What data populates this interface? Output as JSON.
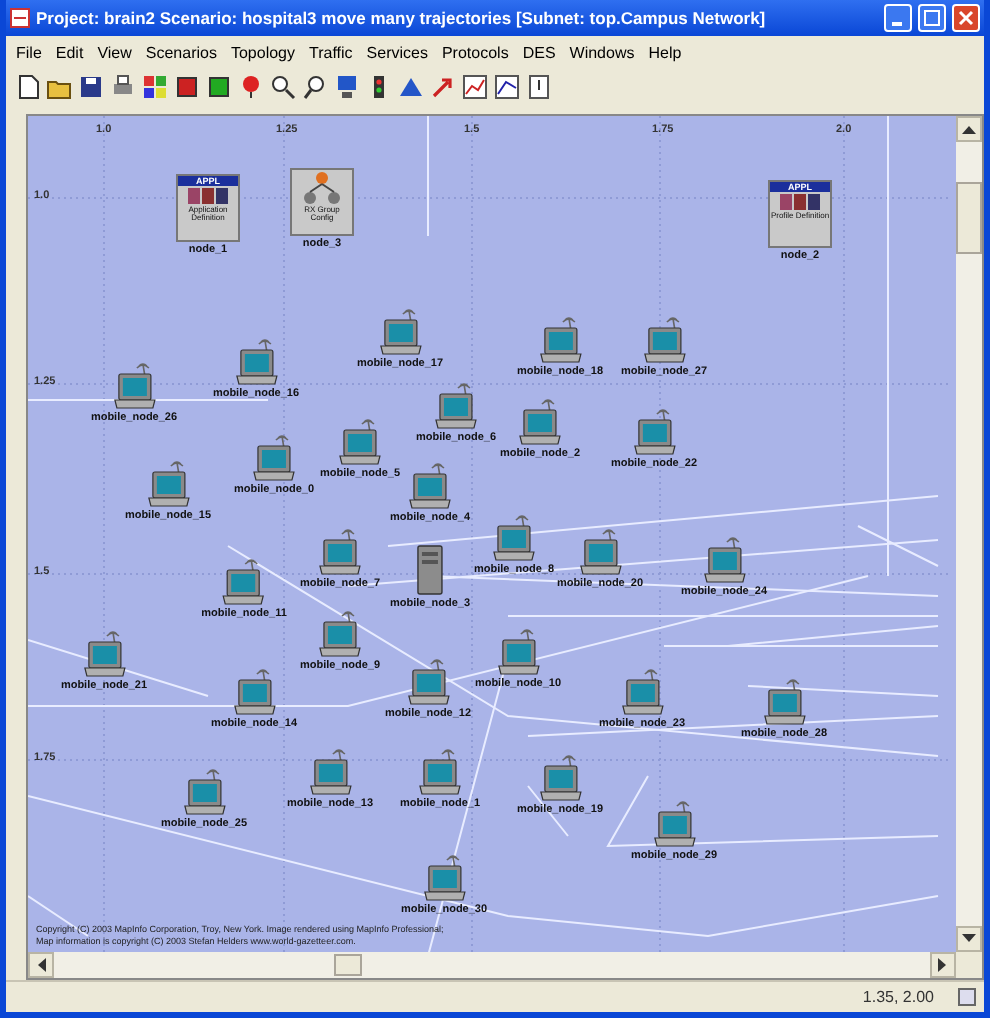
{
  "window": {
    "title": "Project: brain2 Scenario: hospital3 move many trajectories  [Subnet: top.Campus Network]"
  },
  "menu": [
    "File",
    "Edit",
    "View",
    "Scenarios",
    "Topology",
    "Traffic",
    "Services",
    "Protocols",
    "DES",
    "Windows",
    "Help"
  ],
  "canvas": {
    "x_ticks": [
      "1.0",
      "1.25",
      "1.5",
      "1.75",
      "2.0"
    ],
    "y_ticks": [
      "1.0",
      "1.25",
      "1.5",
      "1.75"
    ],
    "nodes": [
      {
        "kind": "application_definition",
        "badge": "APPL",
        "caption": "Application Definition",
        "label": "node_1"
      },
      {
        "kind": "rx_group_config",
        "caption": "RX Group Config",
        "label": "node_3"
      },
      {
        "kind": "profile_definition",
        "badge": "APPL",
        "caption": "Profile Definition",
        "label": "node_2"
      },
      {
        "kind": "laptop",
        "label": "mobile_node_17"
      },
      {
        "kind": "laptop",
        "label": "mobile_node_18"
      },
      {
        "kind": "laptop",
        "label": "mobile_node_27"
      },
      {
        "kind": "laptop",
        "label": "mobile_node_26"
      },
      {
        "kind": "laptop",
        "label": "mobile_node_16"
      },
      {
        "kind": "laptop",
        "label": "mobile_node_6"
      },
      {
        "kind": "laptop",
        "label": "mobile_node_2"
      },
      {
        "kind": "laptop",
        "label": "mobile_node_22"
      },
      {
        "kind": "laptop",
        "label": "mobile_node_5"
      },
      {
        "kind": "laptop",
        "label": "mobile_node_0"
      },
      {
        "kind": "laptop",
        "label": "mobile_node_15"
      },
      {
        "kind": "laptop",
        "label": "mobile_node_4"
      },
      {
        "kind": "laptop",
        "label": "mobile_node_7"
      },
      {
        "kind": "laptop",
        "label": "mobile_node_8"
      },
      {
        "kind": "laptop",
        "label": "mobile_node_20"
      },
      {
        "kind": "laptop",
        "label": "mobile_node_24"
      },
      {
        "kind": "laptop",
        "label": "mobile_node_11"
      },
      {
        "kind": "server",
        "label": "mobile_node_3"
      },
      {
        "kind": "laptop",
        "label": "mobile_node_9"
      },
      {
        "kind": "laptop",
        "label": "mobile_node_21"
      },
      {
        "kind": "laptop",
        "label": "mobile_node_10"
      },
      {
        "kind": "laptop",
        "label": "mobile_node_14"
      },
      {
        "kind": "laptop",
        "label": "mobile_node_12"
      },
      {
        "kind": "laptop",
        "label": "mobile_node_23"
      },
      {
        "kind": "laptop",
        "label": "mobile_node_28"
      },
      {
        "kind": "laptop",
        "label": "mobile_node_13"
      },
      {
        "kind": "laptop",
        "label": "mobile_node_1"
      },
      {
        "kind": "laptop",
        "label": "mobile_node_25"
      },
      {
        "kind": "laptop",
        "label": "mobile_node_19"
      },
      {
        "kind": "laptop",
        "label": "mobile_node_29"
      },
      {
        "kind": "laptop",
        "label": "mobile_node_30"
      }
    ],
    "copyright": [
      "Copyright (C) 2003 MapInfo Corporation, Troy, New York. Image rendered using MapInfo Professional;",
      "Map information is copyright (C) 2003 Stefan Helders www.world-gazetteer.com."
    ]
  },
  "status_bar": {
    "coordinates": "1.35, 2.00"
  }
}
